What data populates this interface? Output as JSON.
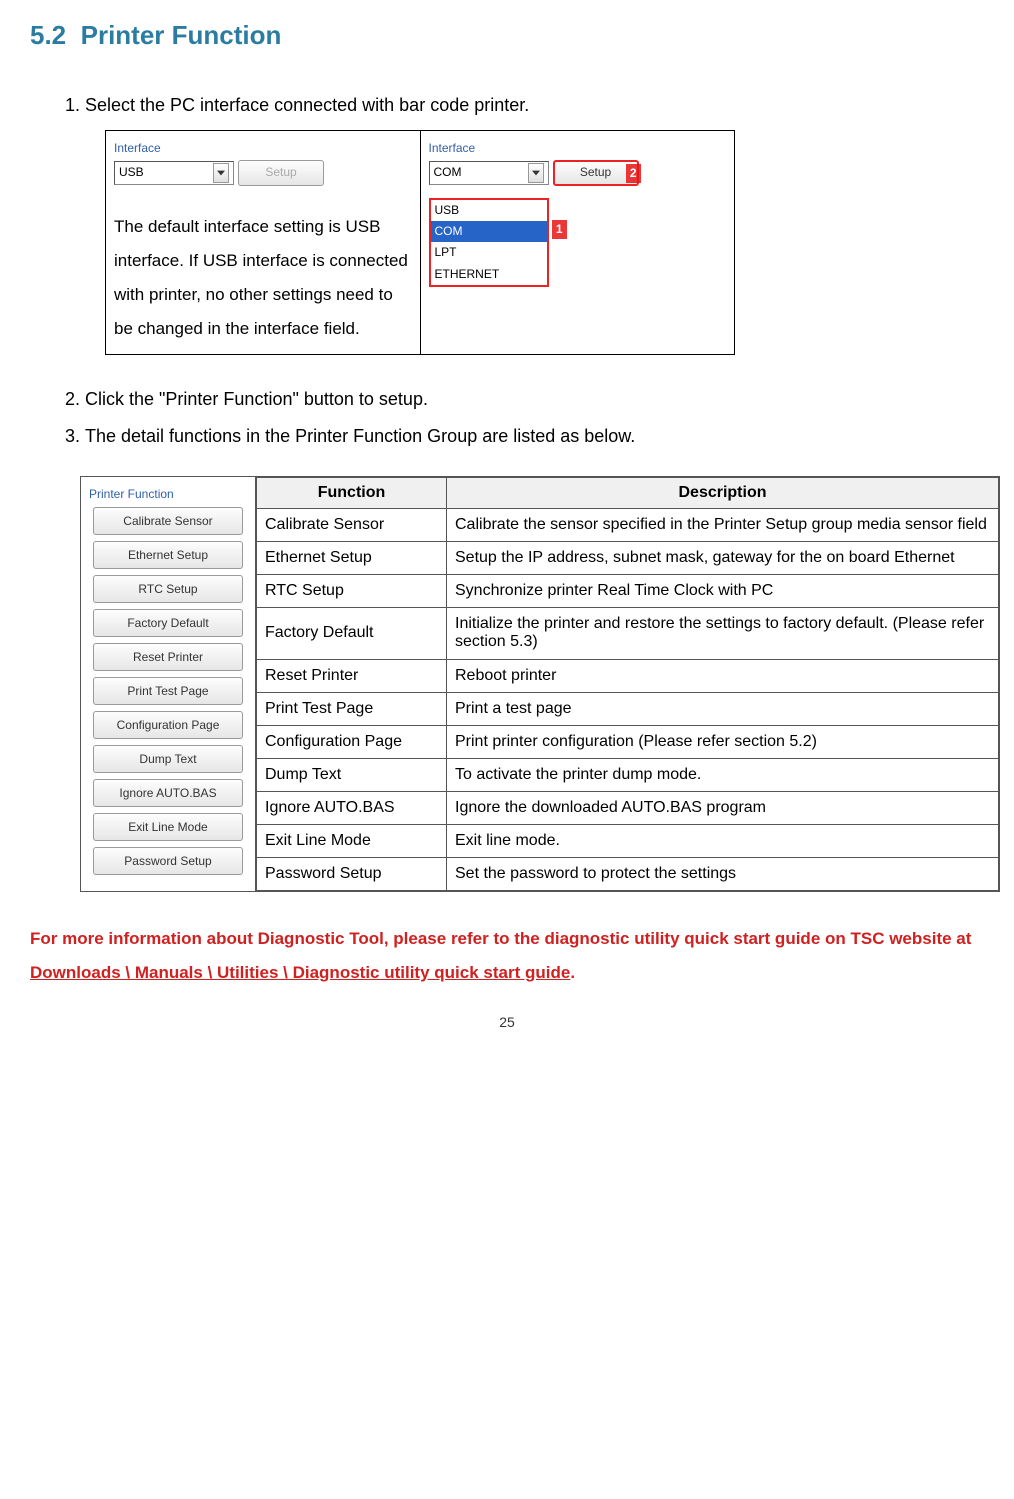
{
  "section": {
    "number": "5.2",
    "title": "Printer Function"
  },
  "steps": {
    "s1": "Select the PC interface connected with bar code printer.",
    "s2": "Click the \"Printer Function\" button to setup.",
    "s3": "The detail functions in the Printer Function Group are listed as below."
  },
  "interface_left": {
    "label": "Interface",
    "combo_value": "USB",
    "setup_btn": "Setup",
    "note": "The default interface setting is USB interface. If USB interface is connected with printer, no other settings need to be changed in the interface field."
  },
  "interface_right": {
    "label": "Interface",
    "combo_value": "COM",
    "setup_btn": "Setup",
    "options": [
      "USB",
      "COM",
      "LPT",
      "ETHERNET"
    ],
    "selected_index": 1,
    "callout1": "1",
    "callout2": "2"
  },
  "printer_function_panel": {
    "label": "Printer Function",
    "buttons": [
      "Calibrate Sensor",
      "Ethernet Setup",
      "RTC Setup",
      "Factory Default",
      "Reset Printer",
      "Print Test Page",
      "Configuration Page",
      "Dump Text",
      "Ignore AUTO.BAS",
      "Exit Line Mode",
      "Password Setup"
    ]
  },
  "function_table": {
    "header_function": "Function",
    "header_description": "Description",
    "rows": [
      {
        "f": "Calibrate Sensor",
        "d": "Calibrate the sensor specified in the Printer Setup group media sensor field"
      },
      {
        "f": "Ethernet Setup",
        "d": "Setup the IP address, subnet mask, gateway for the on board Ethernet"
      },
      {
        "f": "RTC Setup",
        "d": "Synchronize printer Real Time Clock with PC"
      },
      {
        "f": "Factory Default",
        "d": "Initialize the printer and restore the settings to factory default. (Please refer section 5.3)"
      },
      {
        "f": "Reset Printer",
        "d": "Reboot printer"
      },
      {
        "f": "Print Test Page",
        "d": "Print a test page"
      },
      {
        "f": "Configuration Page",
        "d": "Print printer configuration (Please refer section 5.2)"
      },
      {
        "f": "Dump Text",
        "d": "To activate the printer dump mode."
      },
      {
        "f": "Ignore AUTO.BAS",
        "d": "Ignore the downloaded AUTO.BAS program"
      },
      {
        "f": "Exit Line Mode",
        "d": "Exit line mode."
      },
      {
        "f": "Password Setup",
        "d": "Set the password to protect the settings"
      }
    ]
  },
  "footer": {
    "text_before": "For more information about Diagnostic Tool, please refer to the diagnostic utility quick start guide on TSC website at ",
    "link": "Downloads \\ Manuals \\ Utilities \\ Diagnostic utility quick start guide",
    "text_after": "."
  },
  "page_number": "25"
}
